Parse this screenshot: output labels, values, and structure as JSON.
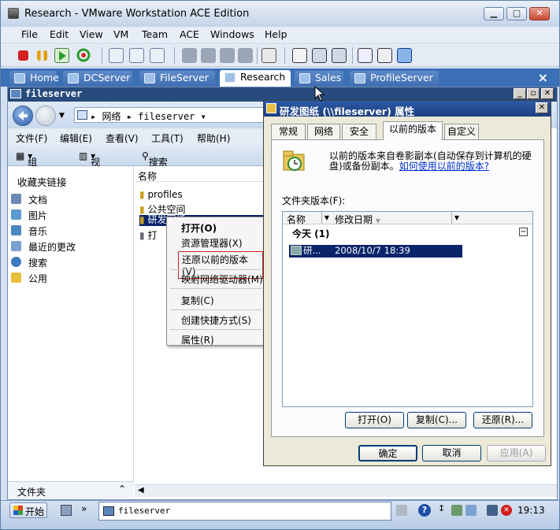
{
  "vmware": {
    "title": "Research - VMware Workstation ACE Edition",
    "menu": [
      "File",
      "Edit",
      "View",
      "VM",
      "Team",
      "ACE",
      "Windows",
      "Help"
    ],
    "tabs": [
      "Home",
      "DCServer",
      "FileServer",
      "Research",
      "Sales",
      "ProfileServer"
    ],
    "active_tab": "Research",
    "tab_close": "×"
  },
  "explorer": {
    "title": "fileserver",
    "address": [
      "网络",
      "fileserver"
    ],
    "menu": [
      "文件(F)",
      "编辑(E)",
      "查看(V)",
      "工具(T)",
      "帮助(H)"
    ],
    "toolbar": {
      "organize": "组织",
      "views": "视图",
      "search": "搜索 Active Directory"
    },
    "favorites_title": "收藏夹链接",
    "favorites": [
      "文档",
      "图片",
      "音乐",
      "最近的更改",
      "搜索",
      "公用"
    ],
    "folders_label": "文件夹",
    "column_name": "名称",
    "files": [
      "profiles",
      "公共空间",
      "研发图纸",
      "打"
    ]
  },
  "context_menu": {
    "items": [
      "打开(O)",
      "资源管理器(X)",
      "还原以前的版本(V)",
      "映射网络驱动器(M)",
      "复制(C)",
      "创建快捷方式(S)",
      "属性(R)"
    ]
  },
  "dialog": {
    "title": "研发图纸 (\\\\fileserver) 属性",
    "tabs": [
      "常规",
      "网络",
      "安全",
      "以前的版本",
      "自定义"
    ],
    "active_tab": "以前的版本",
    "info_text_1": "以前的版本来自卷影副本(自动保存到计算机的硬",
    "info_text_2": "盘)或备份副本。",
    "info_link": "如何使用以前的版本?",
    "list_label": "文件夹版本(F):",
    "col_name": "名称",
    "col_date": "修改日期",
    "group": "今天 (1)",
    "version_name": "研...",
    "version_date": "2008/10/7 18:39",
    "buttons": {
      "open": "打开(O)",
      "copy": "复制(C)...",
      "restore": "还原(R)..."
    },
    "footer": {
      "ok": "确定",
      "cancel": "取消",
      "apply": "应用(A)"
    }
  },
  "taskbar": {
    "start": "开始",
    "app": "fileserver",
    "time": "19:13"
  },
  "colors": {
    "vm_tabbar": "#3b6fb6",
    "explorer_title": "#274b7c",
    "dialog_title": "#1d3f7e",
    "selection": "#0a246a",
    "highlight_box": "#d02020"
  }
}
